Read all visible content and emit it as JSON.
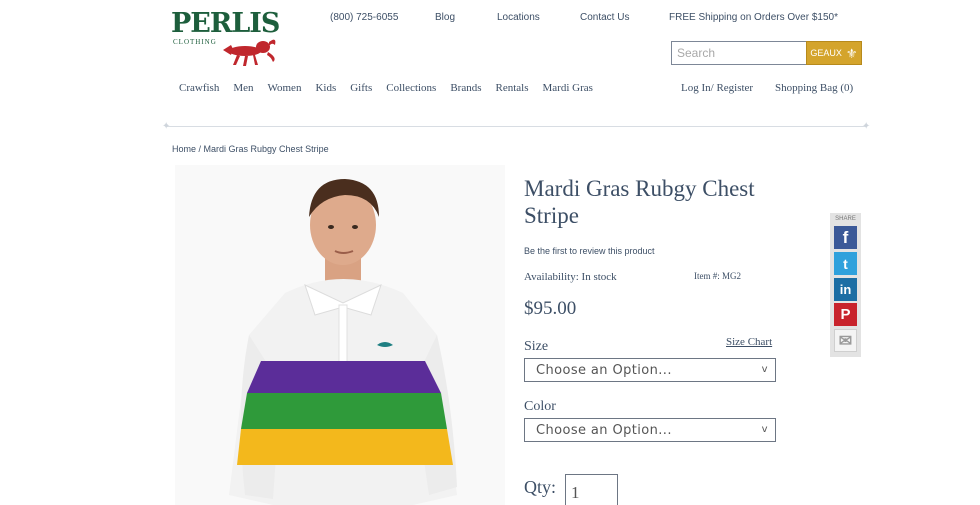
{
  "logo": {
    "text": "PERLIS",
    "subtext": "CLOTHING"
  },
  "header": {
    "phone": "(800) 725-6055",
    "blog": "Blog",
    "locations": "Locations",
    "contact": "Contact Us",
    "shipping": "FREE Shipping on Orders Over $150*"
  },
  "search": {
    "placeholder": "Search",
    "button_label": "GEAUX",
    "button_icon": "fleur-de-lis-icon"
  },
  "nav": {
    "items": [
      "Crawfish",
      "Men",
      "Women",
      "Kids",
      "Gifts",
      "Collections",
      "Brands",
      "Rentals",
      "Mardi Gras"
    ],
    "login": "Log In/ Register",
    "bag": "Shopping Bag (0)"
  },
  "breadcrumb": {
    "home": "Home",
    "separator": " / ",
    "current": "Mardi Gras Rubgy Chest Stripe"
  },
  "product": {
    "title": "Mardi Gras Rubgy Chest Stripe",
    "review": "Be the first to review this product",
    "availability": "Availability: In stock",
    "item_no": "Item #: MG2",
    "price": "$95.00",
    "size_label": "Size",
    "size_chart": "Size Chart",
    "size_placeholder": "Choose an Option...",
    "color_label": "Color",
    "color_placeholder": "Choose an Option...",
    "select_chevron": "v",
    "qty_label": "Qty:",
    "qty_value": "1"
  },
  "share": {
    "label": "SHARE",
    "buttons": [
      {
        "icon": "facebook-icon",
        "glyph": "f",
        "color": "#3b5998"
      },
      {
        "icon": "twitter-icon",
        "glyph": "t",
        "color": "#2fa1dc"
      },
      {
        "icon": "linkedin-icon",
        "glyph": "in",
        "color": "#1c6ea4"
      },
      {
        "icon": "pinterest-icon",
        "glyph": "P",
        "color": "#c8232c"
      },
      {
        "icon": "email-icon",
        "glyph": "✉",
        "color": "#d0d0d0"
      }
    ]
  },
  "colors": {
    "text": "#3d4f66",
    "brand_green": "#1d5e3c",
    "accent_gold": "#d4a42c",
    "stripe_purple": "#5b2d99",
    "stripe_green": "#2f9a3a",
    "stripe_gold": "#f3b81c"
  }
}
